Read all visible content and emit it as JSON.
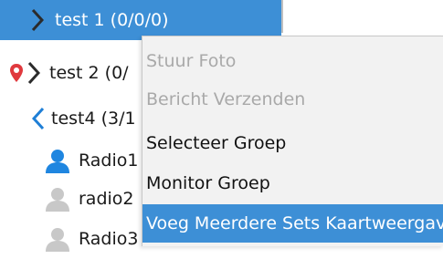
{
  "tree": {
    "items": [
      {
        "label": "test 1 (0/0/0)",
        "icon": "chevron-right-icon"
      },
      {
        "label": "test 2 (0/",
        "icon": "location-pin-chevron-icon"
      },
      {
        "label": "test4 (3/1",
        "icon": "chevron-left-icon"
      },
      {
        "label": "Radio1",
        "icon": "user-online-icon"
      },
      {
        "label": "radio2",
        "icon": "user-offline-icon"
      },
      {
        "label": "Radio3",
        "icon": "user-offline-icon"
      }
    ]
  },
  "context_menu": {
    "items": [
      {
        "label": "Stuur Foto",
        "state": "disabled"
      },
      {
        "label": "Bericht Verzenden",
        "state": "disabled"
      },
      {
        "label": "Selecteer Groep",
        "state": "enabled"
      },
      {
        "label": "Monitor Groep",
        "state": "enabled"
      },
      {
        "label": "Voeg Meerdere Sets Kaartweergave",
        "state": "highlighted"
      }
    ]
  },
  "colors": {
    "selection": "#3d8fd6",
    "pin": "#e0393e",
    "chevron_dark": "#333333",
    "chevron_blue": "#1f7fd6",
    "user_online": "#1f86e0",
    "user_offline": "#c8c8c8"
  }
}
